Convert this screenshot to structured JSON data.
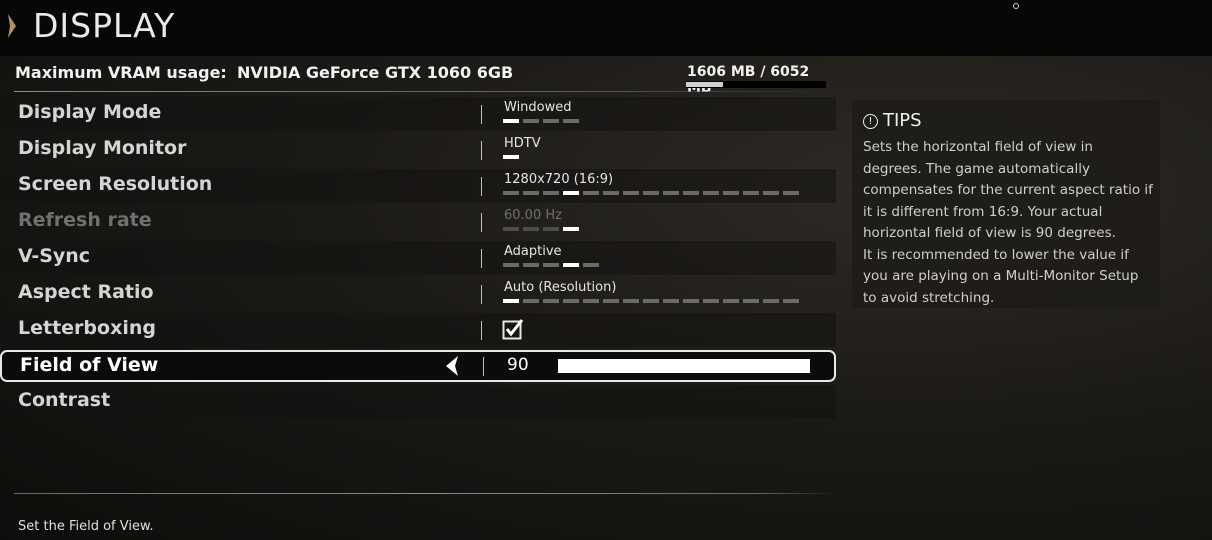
{
  "header": {
    "title": "DISPLAY"
  },
  "vram": {
    "label": "Maximum VRAM usage:",
    "gpu": "NVIDIA GeForce GTX 1060 6GB",
    "usage_text": "1606 MB / 6052 MB",
    "used_mb": 1606,
    "total_mb": 6052
  },
  "settings": [
    {
      "label": "Display Mode",
      "value": "Windowed",
      "options": 4,
      "selected": 0
    },
    {
      "label": "Display Monitor",
      "value": "HDTV",
      "options": 1,
      "selected": 0
    },
    {
      "label": "Screen Resolution",
      "value": "1280x720 (16:9)",
      "options": 15,
      "selected": 3
    },
    {
      "label": "Refresh rate",
      "value": "60.00 Hz",
      "options": 4,
      "selected": 3,
      "disabled": true
    },
    {
      "label": "V-Sync",
      "value": "Adaptive",
      "options": 5,
      "selected": 3
    },
    {
      "label": "Aspect Ratio",
      "value": "Auto (Resolution)",
      "options": 15,
      "selected": 0
    },
    {
      "label": "Letterboxing",
      "checked": true
    },
    {
      "label": "Field of View",
      "value": "90",
      "slider_fraction": 1.0
    },
    {
      "label": "Contrast"
    }
  ],
  "tips": {
    "title": "TIPS",
    "text": "Sets the horizontal field of view in degrees. The game automatically compensates for the current aspect ratio if it is different from 16:9. Your actual horizontal field of view is 90 degrees.\nIt is recommended to lower the value if you are playing on a Multi-Monitor Setup to avoid stretching."
  },
  "footer": {
    "hint": "Set the Field of View."
  }
}
